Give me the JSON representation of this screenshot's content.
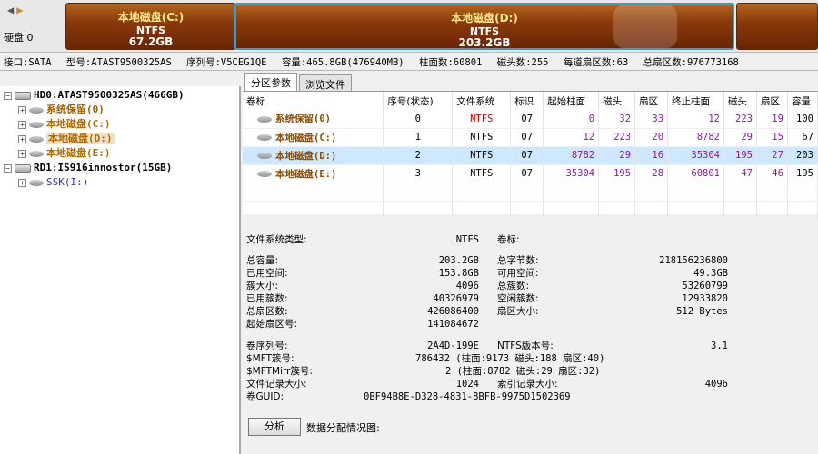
{
  "disk_map": {
    "disk_label": "硬盘 0",
    "partitions": [
      {
        "name": "本地磁盘(C:)",
        "fs": "NTFS",
        "size": "67.2GB"
      },
      {
        "name": "本地磁盘(D:)",
        "fs": "NTFS",
        "size": "203.2GB"
      }
    ]
  },
  "info_line": {
    "interface": "接口:SATA",
    "model": "型号:ATAST9500325AS",
    "serial": "序列号:V5CEG1QE",
    "capacity": "容量:465.8GB(476940MB)",
    "cylinders": "柱面数:60801",
    "heads": "磁头数:255",
    "sectors_per_track": "每道扇区数:63",
    "total_sectors": "总扇区数:976773168"
  },
  "tree": {
    "disk0": "HD0:ATAST9500325AS(466GB)",
    "disk0_children": [
      "系统保留(0)",
      "本地磁盘(C:)",
      "本地磁盘(D:)",
      "本地磁盘(E:)"
    ],
    "disk1": "RD1:IS916innostor(15GB)",
    "disk1_children": [
      "SSK(I:)"
    ]
  },
  "tabs": [
    "分区参数",
    "浏览文件"
  ],
  "table": {
    "headers": [
      "卷标",
      "序号(状态)",
      "文件系统",
      "标识",
      "起始柱面",
      "磁头",
      "扇区",
      "终止柱面",
      "磁头",
      "扇区",
      "容量"
    ],
    "rows": [
      [
        "系统保留(0)",
        "0",
        "NTFS",
        "07",
        "0",
        "32",
        "33",
        "12",
        "223",
        "19",
        "100"
      ],
      [
        "本地磁盘(C:)",
        "1",
        "NTFS",
        "07",
        "12",
        "223",
        "20",
        "8782",
        "29",
        "15",
        "67"
      ],
      [
        "本地磁盘(D:)",
        "2",
        "NTFS",
        "07",
        "8782",
        "29",
        "16",
        "35304",
        "195",
        "27",
        "203"
      ],
      [
        "本地磁盘(E:)",
        "3",
        "NTFS",
        "07",
        "35304",
        "195",
        "28",
        "60801",
        "47",
        "46",
        "195"
      ]
    ]
  },
  "detail": {
    "fs_type_label": "文件系统类型:",
    "fs_type": "NTFS",
    "volume_label": "卷标:",
    "total_cap_label": "总容量:",
    "total_cap": "203.2GB",
    "total_bytes_label": "总字节数:",
    "total_bytes": "218156236800",
    "used_label": "已用空间:",
    "used": "153.8GB",
    "free_label": "可用空间:",
    "free": "49.3GB",
    "cluster_label": "簇大小:",
    "cluster": "4096",
    "total_clusters_label": "总簇数:",
    "total_clusters": "53260799",
    "used_clusters_label": "已用簇数:",
    "used_clusters": "40326979",
    "free_clusters_label": "空闲簇数:",
    "free_clusters": "12933820",
    "total_sectors_label": "总扇区数:",
    "total_sectors": "426086400",
    "sector_size_label": "扇区大小:",
    "sector_size": "512 Bytes",
    "start_sector_label": "起始扇区号:",
    "start_sector": "141084672",
    "serial_label": "卷序列号:",
    "serial": "2A4D-199E",
    "ntfs_ver_label": "NTFS版本号:",
    "ntfs_ver": "3.1",
    "mft_label": "$MFT簇号:",
    "mft": "786432 (柱面:9173 磁头:188 扇区:40)",
    "mftmirr_label": "$MFTMirr簇号:",
    "mftmirr": "2 (柱面:8782 磁头:29 扇区:32)",
    "record_label": "文件记录大小:",
    "record": "1024",
    "index_label": "索引记录大小:",
    "index": "4096",
    "guid_label": "卷GUID:",
    "guid": "0BF94B8E-D328-4831-8BFB-9975D1502369",
    "analyze_button": "分析",
    "alloc_label": "数据分配情况图:"
  }
}
